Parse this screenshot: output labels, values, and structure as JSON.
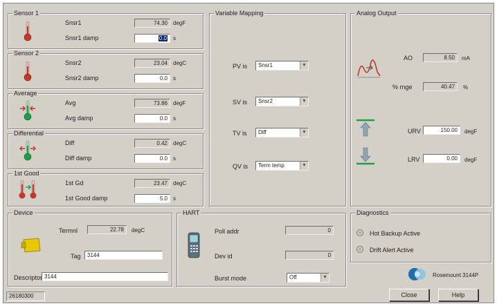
{
  "sensor1": {
    "title": "Sensor 1",
    "rows": [
      {
        "label": "Snsr1",
        "value": "74.30",
        "unit": "degF"
      },
      {
        "label": "Snsr1 damp",
        "value": "0.0",
        "unit": "s"
      }
    ]
  },
  "sensor2": {
    "title": "Sensor 2",
    "rows": [
      {
        "label": "Snsr2",
        "value": "23.04",
        "unit": "degC"
      },
      {
        "label": "Snsr2 damp",
        "value": "0.0",
        "unit": "s"
      }
    ]
  },
  "average": {
    "title": "Average",
    "rows": [
      {
        "label": "Avg",
        "value": "73.86",
        "unit": "degF"
      },
      {
        "label": "Avg damp",
        "value": "0.0",
        "unit": "s"
      }
    ]
  },
  "differential": {
    "title": "Differential",
    "rows": [
      {
        "label": "Diff",
        "value": "0.42",
        "unit": "degC"
      },
      {
        "label": "Diff damp",
        "value": "0.0",
        "unit": "s"
      }
    ]
  },
  "firstgood": {
    "title": "1st Good",
    "rows": [
      {
        "label": "1st Gd",
        "value": "23.47",
        "unit": "degC"
      },
      {
        "label": "1st Good damp",
        "value": "5.0",
        "unit": "s"
      }
    ]
  },
  "mapping": {
    "title": "Variable Mapping",
    "rows": [
      {
        "label": "PV is",
        "value": "Snsr1"
      },
      {
        "label": "SV is",
        "value": "Snsr2"
      },
      {
        "label": "TV is",
        "value": "Diff"
      },
      {
        "label": "QV is",
        "value": "Term temp"
      }
    ]
  },
  "analog": {
    "title": "Analog Output",
    "rows": [
      {
        "label": "AO",
        "value": "8.50",
        "unit": "mA"
      },
      {
        "label": "% rnge",
        "value": "40.47",
        "unit": "%"
      },
      {
        "label": "URV",
        "value": "150.00",
        "unit": "degF"
      },
      {
        "label": "LRV",
        "value": "0.00",
        "unit": "degF"
      }
    ]
  },
  "device": {
    "title": "Device",
    "terminal_label": "Termnl",
    "terminal_value": "22.78",
    "terminal_unit": "degC",
    "tag_label": "Tag",
    "tag_value": "3144",
    "descriptor_label": "Descriptor",
    "descriptor_value": "3144"
  },
  "hart": {
    "title": "HART",
    "poll_label": "Poll addr",
    "poll_value": "0",
    "devid_label": "Dev id",
    "devid_value": "0",
    "burst_label": "Burst mode",
    "burst_value": "Off"
  },
  "diagnostics": {
    "title": "Diagnostics",
    "items": [
      "Hot Backup Active",
      "Drift Alert Active"
    ]
  },
  "brand": "Rosemount 3144P",
  "status_code": "26180300",
  "buttons": {
    "close": "Close",
    "help": "Help"
  },
  "icons": {
    "sensor": "thermometer-icon",
    "average": "thermometer-arrows-icon",
    "differential": "thermometer-arrows-icon",
    "firstgood": "dual-thermometer-icon",
    "device": "device-module-icon",
    "hart": "hart-communicator-icon",
    "analog": "analog-signal-icon",
    "urv": "up-arrow-icon",
    "lrv": "down-arrow-icon",
    "brand": "rosemount-logo-icon"
  },
  "colors": {
    "accent_red": "#c0392b",
    "accent_green": "#1e9e4a",
    "select_blue": "#0a246a",
    "device_yellow": "#e8c800"
  }
}
